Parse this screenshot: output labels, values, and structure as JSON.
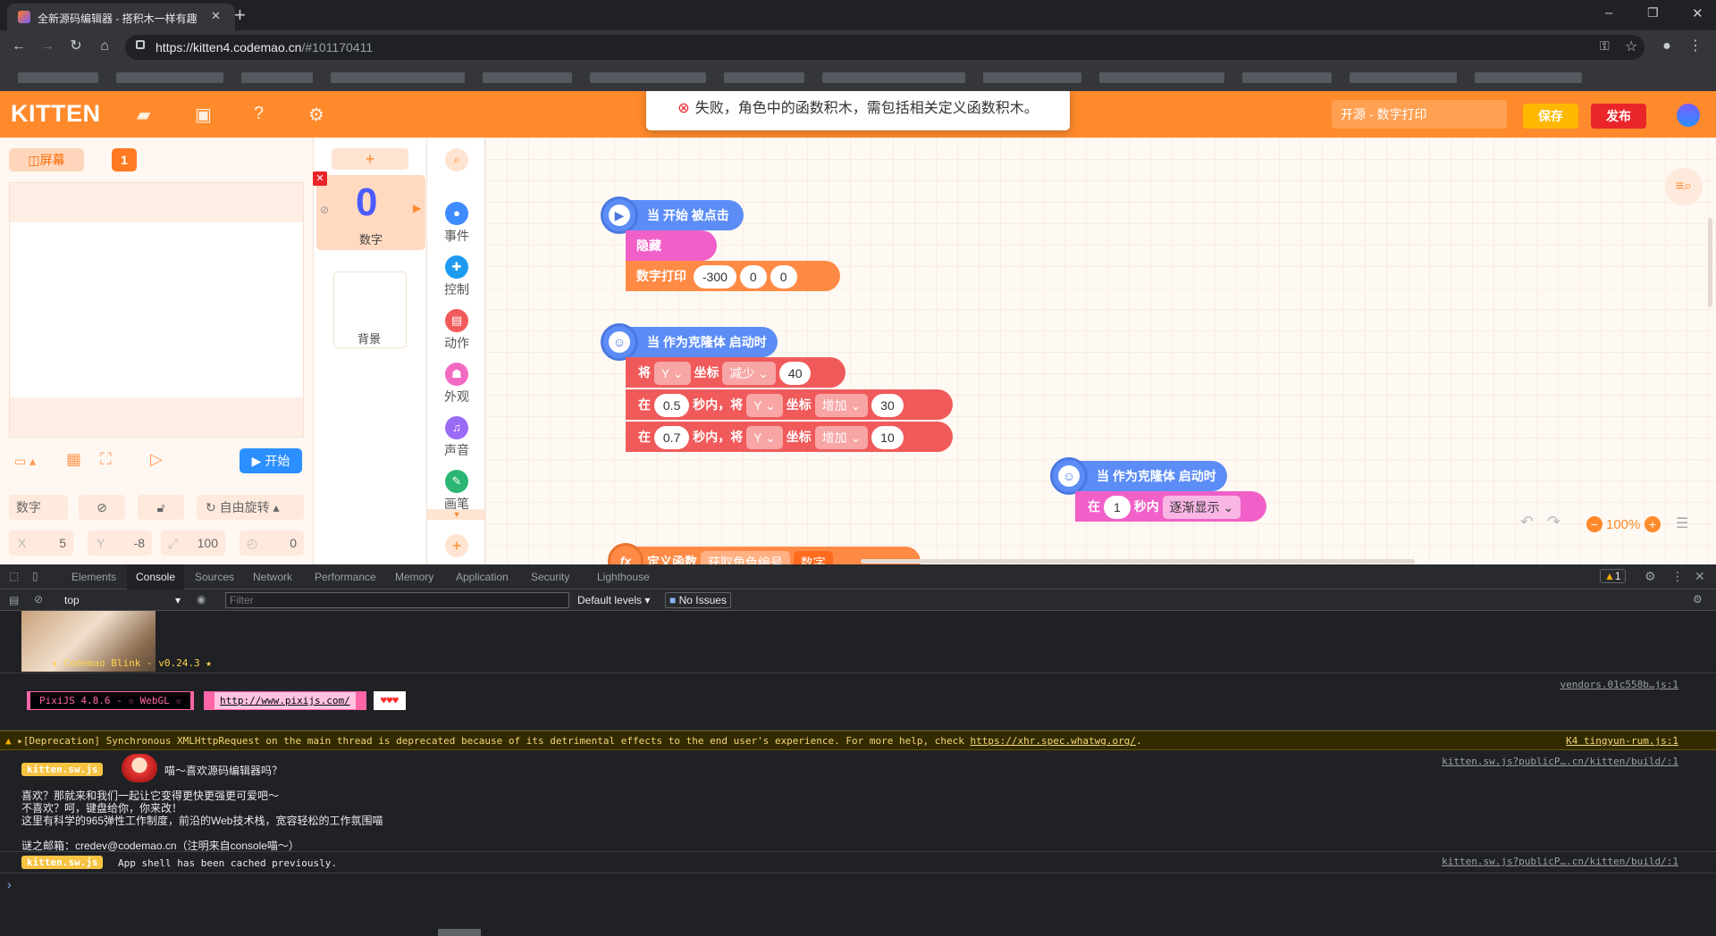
{
  "browser": {
    "tab_title": "全新源码编辑器 - 搭积木一样有趣",
    "new_tab": "+",
    "url_host": "https://kitten4.codemao.cn",
    "url_rest": "/#101170411",
    "win_min": "–",
    "win_restore": "❐",
    "win_close": "✕"
  },
  "header": {
    "logo": "KITTEN",
    "project_name": "开源 - 数字打印",
    "save_label": "保存",
    "publish_label": "发布"
  },
  "toast": {
    "message": "失败，角色中的函数积木，需包括相关定义函数积木。"
  },
  "stage": {
    "screen_tab": "屏幕",
    "screen_num": "1",
    "start_label": "开始",
    "sprite_name_field": "数字",
    "rotation_mode": "自由旋转",
    "x_label": "X",
    "x_value": "5",
    "y_label": "Y",
    "y_value": "-8",
    "size_value": "100",
    "rotation_value": "0"
  },
  "sprites": {
    "add": "+",
    "sprite_glyph": "0",
    "sprite_name": "数字",
    "background_name": "背景"
  },
  "categories": [
    {
      "label": "事件",
      "color": "#3d8bff"
    },
    {
      "label": "控制",
      "color": "#1e9bf0"
    },
    {
      "label": "动作",
      "color": "#f25b5b"
    },
    {
      "label": "外观",
      "color": "#f36ac2"
    },
    {
      "label": "声音",
      "color": "#9a6bf5"
    },
    {
      "label": "画笔",
      "color": "#2bb673"
    }
  ],
  "blocks": {
    "script1": {
      "hat": "当 开始 被点击",
      "hide": "隐藏",
      "print_label": "数字打印",
      "print_args": [
        "-300",
        "0",
        "0"
      ]
    },
    "script2": {
      "hat": "当 作为克隆体 启动时",
      "row1": {
        "w1": "将",
        "axis": "Y",
        "w2": "坐标",
        "op": "减少",
        "val": "40"
      },
      "row2": {
        "w1": "在",
        "time": "0.5",
        "w2": "秒内，将",
        "axis": "Y",
        "w3": "坐标",
        "op": "增加",
        "val": "30"
      },
      "row3": {
        "w1": "在",
        "time": "0.7",
        "w2": "秒内，将",
        "axis": "Y",
        "w3": "坐标",
        "op": "增加",
        "val": "10"
      }
    },
    "script3": {
      "hat": "当 作为克隆体 启动时",
      "w1": "在",
      "time": "1",
      "w2": "秒内",
      "effect": "逐渐显示"
    },
    "script4": {
      "label": "定义函数",
      "name": "获取角色编号",
      "param": "数字"
    },
    "zoom": "100%"
  },
  "devtools": {
    "tabs": [
      "Elements",
      "Console",
      "Sources",
      "Network",
      "Performance",
      "Memory",
      "Application",
      "Security",
      "Lighthouse"
    ],
    "warn_count": "1",
    "context": "top",
    "filter_placeholder": "Filter",
    "levels": "Default levels",
    "issues": "No Issues",
    "blink_text": "Codemao Blink - v0.24.3",
    "pixi_text": "PixiJS 4.8.6 - ☆ WebGL ☆",
    "pixi_url": "http://www.pixijs.com/",
    "pixi_hearts": "♥♥♥",
    "vendors_src": "vendors.01c558b…js:1",
    "deprecation_text": "[Deprecation] Synchronous XMLHttpRequest on the main thread is deprecated because of its detrimental effects to the end user's experience. For more help, check",
    "deprecation_link": "https://xhr.spec.whatwg.org/",
    "deprecation_src": "K4  tingyun-rum.js:1",
    "sw_badge": "kitten.sw.js",
    "sw_q": "喵～喜欢源码编辑器吗？",
    "sw_line1": "喜欢？那就来和我们一起让它变得更快更强更可爱吧～",
    "sw_line2": "不喜欢？呵，键盘给你，你来改！",
    "sw_line3": "这里有科学的965弹性工作制度，前沿的Web技术栈，宽容轻松的工作氛围喵",
    "sw_line4": "谜之邮箱：credev@codemao.cn（注明来自console喵～）",
    "sw_src": "kitten.sw.js?publicP….cn/kitten/build/:1",
    "sw_cached": "App shell has been cached previously.",
    "sw_src2": "kitten.sw.js?publicP….cn/kitten/build/:1",
    "prompt": "›"
  }
}
